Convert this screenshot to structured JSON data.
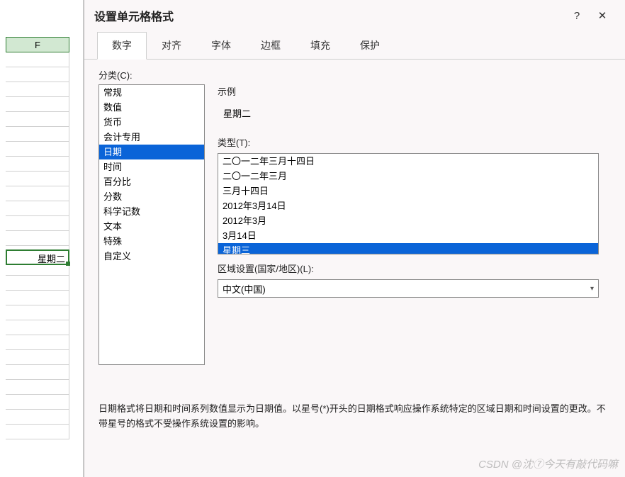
{
  "sheet": {
    "col_header": "F",
    "active_cell_value": "星期二"
  },
  "dialog": {
    "title": "设置单元格格式",
    "help_label": "?",
    "close_label": "✕",
    "tabs": [
      "数字",
      "对齐",
      "字体",
      "边框",
      "填充",
      "保护"
    ],
    "active_tab_index": 0,
    "category_label": "分类(C):",
    "categories": [
      "常规",
      "数值",
      "货币",
      "会计专用",
      "日期",
      "时间",
      "百分比",
      "分数",
      "科学记数",
      "文本",
      "特殊",
      "自定义"
    ],
    "category_selected_index": 4,
    "sample_label": "示例",
    "sample_value": "星期二",
    "type_label": "类型(T):",
    "type_options": [
      "二〇一二年三月十四日",
      "二〇一二年三月",
      "三月十四日",
      "2012年3月14日",
      "2012年3月",
      "3月14日",
      "星期三"
    ],
    "type_selected_index": 6,
    "locale_label": "区域设置(国家/地区)(L):",
    "locale_value": "中文(中国)",
    "description": "日期格式将日期和时间系列数值显示为日期值。以星号(*)开头的日期格式响应操作系统特定的区域日期和时间设置的更改。不带星号的格式不受操作系统设置的影响。"
  },
  "watermark": "CSDN @沈⑦今天有敲代码嘛"
}
